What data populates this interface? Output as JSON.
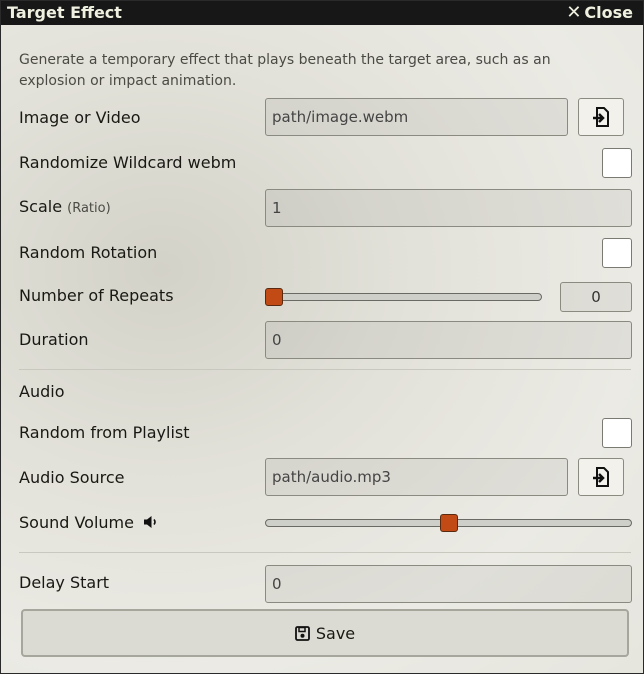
{
  "window": {
    "title": "Target Effect",
    "close_label": "Close"
  },
  "notes": "Generate a temporary effect that plays beneath the target area, such as an explosion or impact animation.",
  "fields": {
    "image_video": {
      "label": "Image or Video",
      "value": "path/image.webm",
      "icon": "file-import-icon"
    },
    "randomize_wildcard": {
      "label": "Randomize Wildcard webm",
      "checked": false
    },
    "scale": {
      "label": "Scale",
      "hint": "(Ratio)",
      "value": "1"
    },
    "random_rotation": {
      "label": "Random Rotation",
      "checked": false
    },
    "repeats": {
      "label": "Number of Repeats",
      "value": "0",
      "slider_fraction": 0.0
    },
    "duration": {
      "label": "Duration",
      "value": "0"
    },
    "audio_header": "Audio",
    "random_playlist": {
      "label": "Random from Playlist",
      "checked": false
    },
    "audio_source": {
      "label": "Audio Source",
      "value": "path/audio.mp3",
      "icon": "file-import-icon"
    },
    "sound_volume": {
      "label": "Sound Volume",
      "icon": "volume-icon",
      "slider_fraction": 0.5
    },
    "delay_start": {
      "label": "Delay Start",
      "value": "0"
    }
  },
  "save_button": {
    "label": "Save",
    "icon": "save-icon"
  },
  "colors": {
    "titlebar": "#171717",
    "slider_thumb": "#c24a14",
    "panel": "#e8e7e0"
  }
}
